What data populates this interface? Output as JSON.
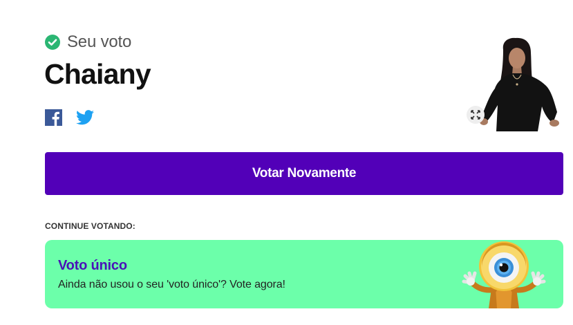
{
  "vote": {
    "status_label": "Seu voto",
    "candidate_name": "Chaiany"
  },
  "share": {
    "facebook_icon": "facebook-icon",
    "twitter_icon": "twitter-icon"
  },
  "photo": {
    "expand_icon": "expand-icon"
  },
  "actions": {
    "vote_again_label": "Votar Novamente"
  },
  "continue": {
    "section_label": "CONTINUE VOTANDO:",
    "card": {
      "title": "Voto único",
      "text": "Ainda não usou o seu 'voto único'? Vote agora!",
      "mascot_icon": "eye-mascot"
    }
  },
  "colors": {
    "primary": "#5200b8",
    "card_background": "#6cffaa",
    "card_title": "#4a11b8",
    "check": "#2bb673",
    "facebook": "#3b5998",
    "twitter": "#1da1f2"
  }
}
